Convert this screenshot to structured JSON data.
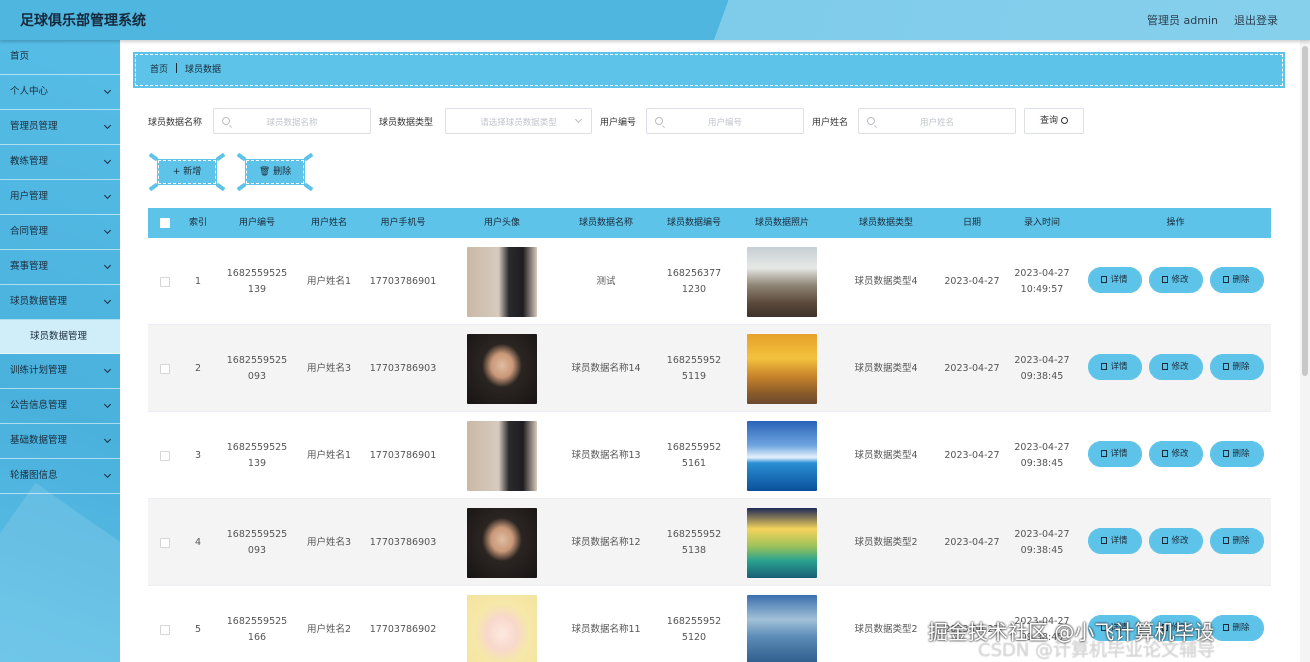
{
  "header": {
    "title": "足球俱乐部管理系统",
    "user": "管理员 admin",
    "logout": "退出登录"
  },
  "sidebar": {
    "items": [
      {
        "label": "首页",
        "chevron": false
      },
      {
        "label": "个人中心",
        "chevron": true
      },
      {
        "label": "管理员管理",
        "chevron": true
      },
      {
        "label": "教练管理",
        "chevron": true
      },
      {
        "label": "用户管理",
        "chevron": true
      },
      {
        "label": "合同管理",
        "chevron": true
      },
      {
        "label": "赛事管理",
        "chevron": true
      },
      {
        "label": "球员数据管理",
        "chevron": true
      }
    ],
    "sub_item": "球员数据管理",
    "items_after": [
      {
        "label": "训练计划管理",
        "chevron": true
      },
      {
        "label": "公告信息管理",
        "chevron": true
      },
      {
        "label": "基础数据管理",
        "chevron": true
      },
      {
        "label": "轮播图信息",
        "chevron": true
      }
    ]
  },
  "breadcrumb": {
    "home": "首页",
    "current": "球员数据"
  },
  "search": {
    "name_label": "球员数据名称",
    "name_placeholder": "球员数据名称",
    "type_label": "球员数据类型",
    "type_placeholder": "请选择球员数据类型",
    "userno_label": "用户编号",
    "userno_placeholder": "用户编号",
    "username_label": "用户姓名",
    "username_placeholder": "用户姓名",
    "query_button": "查询"
  },
  "actions": {
    "add": "新增",
    "delete": "删除"
  },
  "table": {
    "headers": [
      "索引",
      "用户编号",
      "用户姓名",
      "用户手机号",
      "用户头像",
      "球员数据名称",
      "球员数据编号",
      "球员数据照片",
      "球员数据类型",
      "日期",
      "录入时间",
      "操作"
    ],
    "row_buttons": {
      "detail": "详情",
      "edit": "修改",
      "delete": "删除"
    },
    "rows": [
      {
        "index": "1",
        "user_no": "1682559525139",
        "user_name": "用户姓名1",
        "phone": "17703786901",
        "avatar": "avatar-man-wall",
        "data_name": "测试",
        "data_no": "1682563771230",
        "photo": "photo-waterfall",
        "data_type": "球员数据类型4",
        "date": "2023-04-27",
        "entry_date": "2023-04-27",
        "entry_time": "10:49:57"
      },
      {
        "index": "2",
        "user_no": "1682559525093",
        "user_name": "用户姓名3",
        "phone": "17703786903",
        "avatar": "avatar-man-portrait",
        "data_name": "球员数据名称14",
        "data_no": "1682559525119",
        "photo": "photo-autumn",
        "data_type": "球员数据类型4",
        "date": "2023-04-27",
        "entry_date": "2023-04-27",
        "entry_time": "09:38:45"
      },
      {
        "index": "3",
        "user_no": "1682559525139",
        "user_name": "用户姓名1",
        "phone": "17703786901",
        "avatar": "avatar-man-wall",
        "data_name": "球员数据名称13",
        "data_no": "1682559525161",
        "photo": "photo-sea",
        "data_type": "球员数据类型4",
        "date": "2023-04-27",
        "entry_date": "2023-04-27",
        "entry_time": "09:38:45"
      },
      {
        "index": "4",
        "user_no": "1682559525093",
        "user_name": "用户姓名3",
        "phone": "17703786903",
        "avatar": "avatar-man-portrait",
        "data_name": "球员数据名称12",
        "data_no": "1682559525138",
        "photo": "photo-lake-sunset",
        "data_type": "球员数据类型2",
        "date": "2023-04-27",
        "entry_date": "2023-04-27",
        "entry_time": "09:38:45"
      },
      {
        "index": "5",
        "user_no": "1682559525166",
        "user_name": "用户姓名2",
        "phone": "17703786902",
        "avatar": "avatar-anime-girl",
        "data_name": "球员数据名称11",
        "data_no": "1682559525120",
        "photo": "photo-river-aerial",
        "data_type": "球员数据类型2",
        "date": "2023-04-27",
        "entry_date": "2023-04-27",
        "entry_time": "09:38:45"
      }
    ]
  },
  "watermark": "掘金技术社区 @小飞计算机毕设",
  "watermark2": "CSDN @计算机毕业论文辅导",
  "colors": {
    "accent": "#5ec3e8",
    "sidebar": "#4ab1dd",
    "header": "#4fb6e0"
  }
}
